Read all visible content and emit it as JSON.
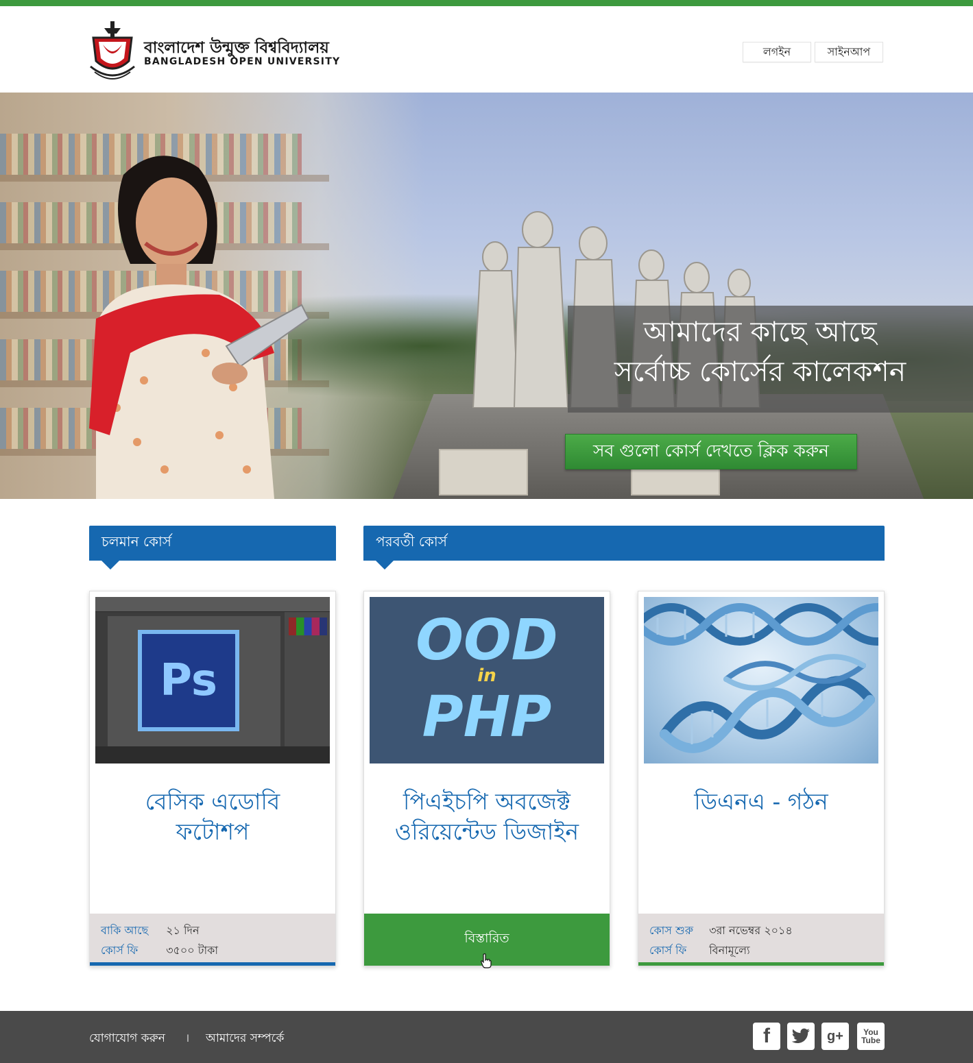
{
  "colors": {
    "accent_green": "#3d9a3e",
    "accent_blue": "#1668b0",
    "footer_bg": "#4a4a4a",
    "card_footer_bg": "#e2dddd"
  },
  "header": {
    "logo_bn": "বাংলাদেশ উন্মুক্ত বিশ্ববিদ্যালয়",
    "logo_en": "BANGLADESH OPEN UNIVERSITY",
    "login_label": "লগইন",
    "signup_label": "সাইনআপ"
  },
  "hero": {
    "title_line1": "আমাদের কাছে আছে",
    "title_line2": "সর্বোচ্চ কোর্সের কালেকশন",
    "cta_label": "সব গুলো কোর্স দেখতে ক্লিক করুন"
  },
  "sections": {
    "current_title": "চলমান কোর্স",
    "next_title": "পরবর্তী কোর্স"
  },
  "courses": [
    {
      "title_line1": "বেসিক এডোবি",
      "title_line2": "ফটোশপ",
      "thumb_text": "Ps",
      "rows": [
        {
          "label": "বাকি আছে",
          "value": "২১ দিন"
        },
        {
          "label": "কোর্স  ফি",
          "value": "৩৫০০ টাকা"
        }
      ]
    },
    {
      "title_line1": "পিএইচপি অবজেক্ট",
      "title_line2": "ওরিয়েন্টেড ডিজাইন",
      "thumb_line1": "OOD",
      "thumb_in": "in",
      "thumb_line2": "PHP",
      "button_label": "বিস্তারিত"
    },
    {
      "title_line1": "ডিএনএ - গঠন",
      "rows": [
        {
          "label": "কোস শুরু",
          "value": "৩রা নভেম্বর ২০১৪"
        },
        {
          "label": "কোর্স  ফি",
          "value": "বিনামূল্যে"
        }
      ]
    }
  ],
  "footer": {
    "contact_label": "যোগাযোগ করুন",
    "separator": "।",
    "about_label": "আমাদের সম্পর্কে",
    "social": {
      "facebook_glyph": "f",
      "googleplus_glyph": "g+",
      "youtube_line1": "You",
      "youtube_line2": "Tube"
    }
  }
}
